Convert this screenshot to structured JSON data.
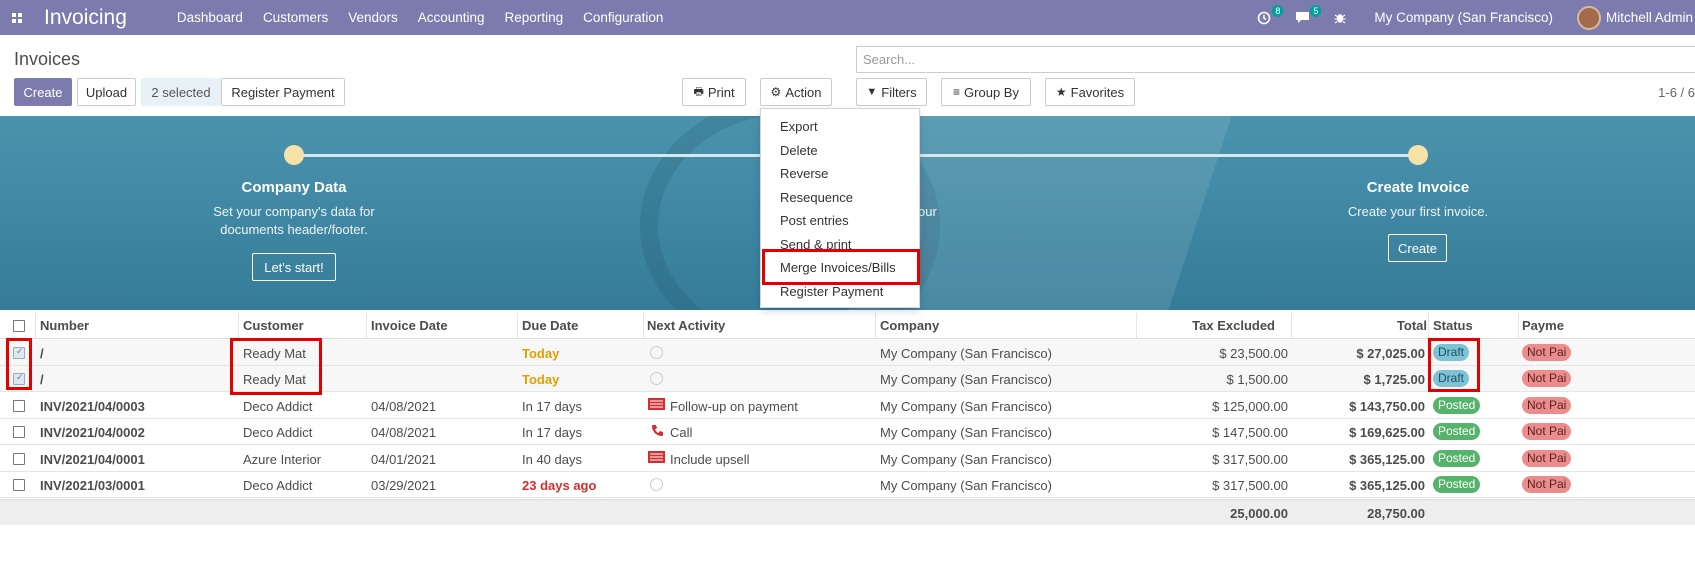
{
  "navbar": {
    "app_name": "Invoicing",
    "menu": [
      "Dashboard",
      "Customers",
      "Vendors",
      "Accounting",
      "Reporting",
      "Configuration"
    ],
    "activity_count": "8",
    "messages_count": "5",
    "company": "My Company (San Francisco)",
    "user": "Mitchell Admin"
  },
  "control_panel": {
    "title": "Invoices",
    "create_label": "Create",
    "upload_label": "Upload",
    "selected_label": "2 selected",
    "register_payment_label": "Register Payment",
    "print_label": "Print",
    "action_label": "Action",
    "search_placeholder": "Search...",
    "filters_label": "Filters",
    "group_by_label": "Group By",
    "favorites_label": "Favorites",
    "pager": "1-6 / 6"
  },
  "action_menu": [
    "Export",
    "Delete",
    "Reverse",
    "Resequence",
    "Post entries",
    "Send & print",
    "Merge Invoices/Bills",
    "Register Payment"
  ],
  "banner": {
    "step1_title": "Company Data",
    "step1_desc1": "Set your company's data for",
    "step1_desc2": "documents header/footer.",
    "step1_button": "Let's start!",
    "step2_desc_fragment": "our",
    "step3_title": "Create Invoice",
    "step3_desc": "Create your first invoice.",
    "step3_button": "Create"
  },
  "table": {
    "columns": [
      "Number",
      "Customer",
      "Invoice Date",
      "Due Date",
      "Next Activity",
      "Company",
      "Tax Excluded",
      "Total",
      "Status",
      "Payme"
    ],
    "rows": [
      {
        "number": "/",
        "customer": "Ready Mat",
        "invoice_date": "",
        "due_date": "Today",
        "activity": "",
        "company": "My Company (San Francisco)",
        "tax_excluded": "$ 23,500.00",
        "total": "$ 27,025.00",
        "status": "Draft",
        "payment": "Not Pai"
      },
      {
        "number": "/",
        "customer": "Ready Mat",
        "invoice_date": "",
        "due_date": "Today",
        "activity": "",
        "company": "My Company (San Francisco)",
        "tax_excluded": "$ 1,500.00",
        "total": "$ 1,725.00",
        "status": "Draft",
        "payment": "Not Pai"
      },
      {
        "number": "INV/2021/04/0003",
        "customer": "Deco Addict",
        "invoice_date": "04/08/2021",
        "due_date": "In 17 days",
        "activity": "Follow-up on payment",
        "company": "My Company (San Francisco)",
        "tax_excluded": "$ 125,000.00",
        "total": "$ 143,750.00",
        "status": "Posted",
        "payment": "Not Pai"
      },
      {
        "number": "INV/2021/04/0002",
        "customer": "Deco Addict",
        "invoice_date": "04/08/2021",
        "due_date": "In 17 days",
        "activity": "Call",
        "company": "My Company (San Francisco)",
        "tax_excluded": "$ 147,500.00",
        "total": "$ 169,625.00",
        "status": "Posted",
        "payment": "Not Pai"
      },
      {
        "number": "INV/2021/04/0001",
        "customer": "Azure Interior",
        "invoice_date": "04/01/2021",
        "due_date": "In 40 days",
        "activity": "Include upsell",
        "company": "My Company (San Francisco)",
        "tax_excluded": "$ 317,500.00",
        "total": "$ 365,125.00",
        "status": "Posted",
        "payment": "Not Pai"
      },
      {
        "number": "INV/2021/03/0001",
        "customer": "Deco Addict",
        "invoice_date": "03/29/2021",
        "due_date": "23 days ago",
        "activity": "",
        "company": "My Company (San Francisco)",
        "tax_excluded": "$ 317,500.00",
        "total": "$ 365,125.00",
        "status": "Posted",
        "payment": "Not Pai"
      }
    ],
    "footer_tax_excluded": "25,000.00",
    "footer_total": "28,750.00"
  }
}
